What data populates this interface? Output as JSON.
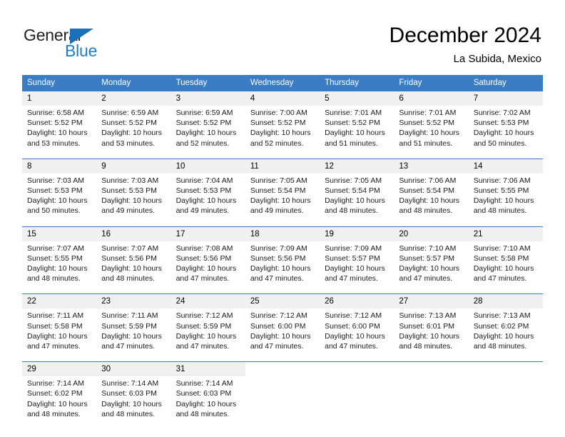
{
  "brand": {
    "name_line1": "General",
    "name_line2": "Blue",
    "triangle_icon": "triangle-icon",
    "color_dark": "#231f20",
    "color_blue": "#1c7fd0"
  },
  "header": {
    "title": "December 2024",
    "subtitle": "La Subida, Mexico"
  },
  "theme": {
    "header_blue": "#3b7dc4",
    "daynum_band": "#f0f0f0",
    "text": "#000000"
  },
  "weekdays": [
    "Sunday",
    "Monday",
    "Tuesday",
    "Wednesday",
    "Thursday",
    "Friday",
    "Saturday"
  ],
  "weeks": [
    [
      {
        "day": "1",
        "sunrise": "Sunrise: 6:58 AM",
        "sunset": "Sunset: 5:52 PM",
        "daylight_line1": "Daylight: 10 hours",
        "daylight_line2": "and 53 minutes."
      },
      {
        "day": "2",
        "sunrise": "Sunrise: 6:59 AM",
        "sunset": "Sunset: 5:52 PM",
        "daylight_line1": "Daylight: 10 hours",
        "daylight_line2": "and 53 minutes."
      },
      {
        "day": "3",
        "sunrise": "Sunrise: 6:59 AM",
        "sunset": "Sunset: 5:52 PM",
        "daylight_line1": "Daylight: 10 hours",
        "daylight_line2": "and 52 minutes."
      },
      {
        "day": "4",
        "sunrise": "Sunrise: 7:00 AM",
        "sunset": "Sunset: 5:52 PM",
        "daylight_line1": "Daylight: 10 hours",
        "daylight_line2": "and 52 minutes."
      },
      {
        "day": "5",
        "sunrise": "Sunrise: 7:01 AM",
        "sunset": "Sunset: 5:52 PM",
        "daylight_line1": "Daylight: 10 hours",
        "daylight_line2": "and 51 minutes."
      },
      {
        "day": "6",
        "sunrise": "Sunrise: 7:01 AM",
        "sunset": "Sunset: 5:52 PM",
        "daylight_line1": "Daylight: 10 hours",
        "daylight_line2": "and 51 minutes."
      },
      {
        "day": "7",
        "sunrise": "Sunrise: 7:02 AM",
        "sunset": "Sunset: 5:53 PM",
        "daylight_line1": "Daylight: 10 hours",
        "daylight_line2": "and 50 minutes."
      }
    ],
    [
      {
        "day": "8",
        "sunrise": "Sunrise: 7:03 AM",
        "sunset": "Sunset: 5:53 PM",
        "daylight_line1": "Daylight: 10 hours",
        "daylight_line2": "and 50 minutes."
      },
      {
        "day": "9",
        "sunrise": "Sunrise: 7:03 AM",
        "sunset": "Sunset: 5:53 PM",
        "daylight_line1": "Daylight: 10 hours",
        "daylight_line2": "and 49 minutes."
      },
      {
        "day": "10",
        "sunrise": "Sunrise: 7:04 AM",
        "sunset": "Sunset: 5:53 PM",
        "daylight_line1": "Daylight: 10 hours",
        "daylight_line2": "and 49 minutes."
      },
      {
        "day": "11",
        "sunrise": "Sunrise: 7:05 AM",
        "sunset": "Sunset: 5:54 PM",
        "daylight_line1": "Daylight: 10 hours",
        "daylight_line2": "and 49 minutes."
      },
      {
        "day": "12",
        "sunrise": "Sunrise: 7:05 AM",
        "sunset": "Sunset: 5:54 PM",
        "daylight_line1": "Daylight: 10 hours",
        "daylight_line2": "and 48 minutes."
      },
      {
        "day": "13",
        "sunrise": "Sunrise: 7:06 AM",
        "sunset": "Sunset: 5:54 PM",
        "daylight_line1": "Daylight: 10 hours",
        "daylight_line2": "and 48 minutes."
      },
      {
        "day": "14",
        "sunrise": "Sunrise: 7:06 AM",
        "sunset": "Sunset: 5:55 PM",
        "daylight_line1": "Daylight: 10 hours",
        "daylight_line2": "and 48 minutes."
      }
    ],
    [
      {
        "day": "15",
        "sunrise": "Sunrise: 7:07 AM",
        "sunset": "Sunset: 5:55 PM",
        "daylight_line1": "Daylight: 10 hours",
        "daylight_line2": "and 48 minutes."
      },
      {
        "day": "16",
        "sunrise": "Sunrise: 7:07 AM",
        "sunset": "Sunset: 5:56 PM",
        "daylight_line1": "Daylight: 10 hours",
        "daylight_line2": "and 48 minutes."
      },
      {
        "day": "17",
        "sunrise": "Sunrise: 7:08 AM",
        "sunset": "Sunset: 5:56 PM",
        "daylight_line1": "Daylight: 10 hours",
        "daylight_line2": "and 47 minutes."
      },
      {
        "day": "18",
        "sunrise": "Sunrise: 7:09 AM",
        "sunset": "Sunset: 5:56 PM",
        "daylight_line1": "Daylight: 10 hours",
        "daylight_line2": "and 47 minutes."
      },
      {
        "day": "19",
        "sunrise": "Sunrise: 7:09 AM",
        "sunset": "Sunset: 5:57 PM",
        "daylight_line1": "Daylight: 10 hours",
        "daylight_line2": "and 47 minutes."
      },
      {
        "day": "20",
        "sunrise": "Sunrise: 7:10 AM",
        "sunset": "Sunset: 5:57 PM",
        "daylight_line1": "Daylight: 10 hours",
        "daylight_line2": "and 47 minutes."
      },
      {
        "day": "21",
        "sunrise": "Sunrise: 7:10 AM",
        "sunset": "Sunset: 5:58 PM",
        "daylight_line1": "Daylight: 10 hours",
        "daylight_line2": "and 47 minutes."
      }
    ],
    [
      {
        "day": "22",
        "sunrise": "Sunrise: 7:11 AM",
        "sunset": "Sunset: 5:58 PM",
        "daylight_line1": "Daylight: 10 hours",
        "daylight_line2": "and 47 minutes."
      },
      {
        "day": "23",
        "sunrise": "Sunrise: 7:11 AM",
        "sunset": "Sunset: 5:59 PM",
        "daylight_line1": "Daylight: 10 hours",
        "daylight_line2": "and 47 minutes."
      },
      {
        "day": "24",
        "sunrise": "Sunrise: 7:12 AM",
        "sunset": "Sunset: 5:59 PM",
        "daylight_line1": "Daylight: 10 hours",
        "daylight_line2": "and 47 minutes."
      },
      {
        "day": "25",
        "sunrise": "Sunrise: 7:12 AM",
        "sunset": "Sunset: 6:00 PM",
        "daylight_line1": "Daylight: 10 hours",
        "daylight_line2": "and 47 minutes."
      },
      {
        "day": "26",
        "sunrise": "Sunrise: 7:12 AM",
        "sunset": "Sunset: 6:00 PM",
        "daylight_line1": "Daylight: 10 hours",
        "daylight_line2": "and 47 minutes."
      },
      {
        "day": "27",
        "sunrise": "Sunrise: 7:13 AM",
        "sunset": "Sunset: 6:01 PM",
        "daylight_line1": "Daylight: 10 hours",
        "daylight_line2": "and 48 minutes."
      },
      {
        "day": "28",
        "sunrise": "Sunrise: 7:13 AM",
        "sunset": "Sunset: 6:02 PM",
        "daylight_line1": "Daylight: 10 hours",
        "daylight_line2": "and 48 minutes."
      }
    ],
    [
      {
        "day": "29",
        "sunrise": "Sunrise: 7:14 AM",
        "sunset": "Sunset: 6:02 PM",
        "daylight_line1": "Daylight: 10 hours",
        "daylight_line2": "and 48 minutes."
      },
      {
        "day": "30",
        "sunrise": "Sunrise: 7:14 AM",
        "sunset": "Sunset: 6:03 PM",
        "daylight_line1": "Daylight: 10 hours",
        "daylight_line2": "and 48 minutes."
      },
      {
        "day": "31",
        "sunrise": "Sunrise: 7:14 AM",
        "sunset": "Sunset: 6:03 PM",
        "daylight_line1": "Daylight: 10 hours",
        "daylight_line2": "and 48 minutes."
      },
      {
        "day": "",
        "sunrise": "",
        "sunset": "",
        "daylight_line1": "",
        "daylight_line2": ""
      },
      {
        "day": "",
        "sunrise": "",
        "sunset": "",
        "daylight_line1": "",
        "daylight_line2": ""
      },
      {
        "day": "",
        "sunrise": "",
        "sunset": "",
        "daylight_line1": "",
        "daylight_line2": ""
      },
      {
        "day": "",
        "sunrise": "",
        "sunset": "",
        "daylight_line1": "",
        "daylight_line2": ""
      }
    ]
  ]
}
